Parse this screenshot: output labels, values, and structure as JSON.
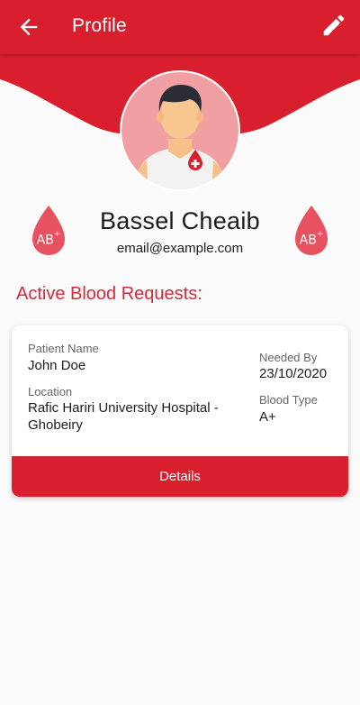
{
  "app_bar": {
    "title": "Profile",
    "back_icon": "arrow-left-icon",
    "edit_icon": "pencil-icon",
    "color": "#d91f2d"
  },
  "profile": {
    "name": "Bassel Cheaib",
    "email": "email@example.com",
    "blood_type_badge": "AB",
    "blood_type_sign": "+"
  },
  "section": {
    "title": "Active Blood Requests:"
  },
  "request_card": {
    "patient_label": "Patient Name",
    "patient_value": "John Doe",
    "location_label": "Location",
    "location_value": "Rafic Hariri University Hospital - Ghobeiry",
    "needed_by_label": "Needed By",
    "needed_by_value": "23/10/2020",
    "blood_type_label": "Blood Type",
    "blood_type_value": "A+",
    "details_button": "Details"
  },
  "colors": {
    "primary_red": "#d91f2d",
    "drop_red": "#e8515f",
    "avatar_bg": "#f0a0a3"
  }
}
